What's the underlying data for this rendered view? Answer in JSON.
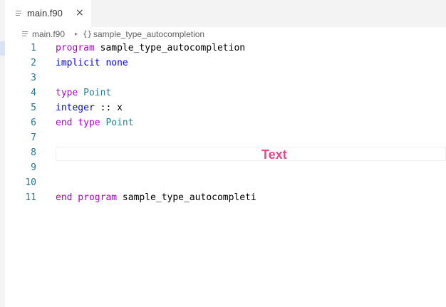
{
  "tab": {
    "title": "main.f90",
    "close_glyph": "×",
    "icon": "file-lines-icon"
  },
  "breadcrumb": {
    "file": "main.f90",
    "separator": "▸",
    "symbol_icon": "{}",
    "symbol": "sample_type_autocompletion"
  },
  "colors": {
    "keyword": "#af00db",
    "storage": "#0000ff",
    "type_name": "#267f99",
    "line_number": "#237893",
    "overlay": "#e8478b"
  },
  "editor": {
    "lines": [
      {
        "number": "1",
        "tokens": [
          {
            "t": "program",
            "c": "kw"
          },
          {
            "t": " sample_type_autocompletion",
            "c": "plain"
          }
        ]
      },
      {
        "number": "2",
        "tokens": [
          {
            "t": "implicit none",
            "c": "kw2"
          }
        ]
      },
      {
        "number": "3",
        "tokens": []
      },
      {
        "number": "4",
        "tokens": [
          {
            "t": "type",
            "c": "kw"
          },
          {
            "t": " ",
            "c": "plain"
          },
          {
            "t": "Point",
            "c": "ty"
          }
        ]
      },
      {
        "number": "5",
        "tokens": [
          {
            "t": "integer",
            "c": "kw2"
          },
          {
            "t": " :: x",
            "c": "plain"
          }
        ]
      },
      {
        "number": "6",
        "tokens": [
          {
            "t": "end type",
            "c": "kw"
          },
          {
            "t": " ",
            "c": "plain"
          },
          {
            "t": "Point",
            "c": "ty"
          }
        ]
      },
      {
        "number": "7",
        "tokens": []
      },
      {
        "number": "8",
        "tokens": []
      },
      {
        "number": "9",
        "tokens": []
      },
      {
        "number": "10",
        "tokens": []
      },
      {
        "number": "11",
        "tokens": [
          {
            "t": "end program",
            "c": "kw"
          },
          {
            "t": " sample_type_autocompleti",
            "c": "plain"
          }
        ]
      }
    ]
  },
  "overlay_label": "Text"
}
